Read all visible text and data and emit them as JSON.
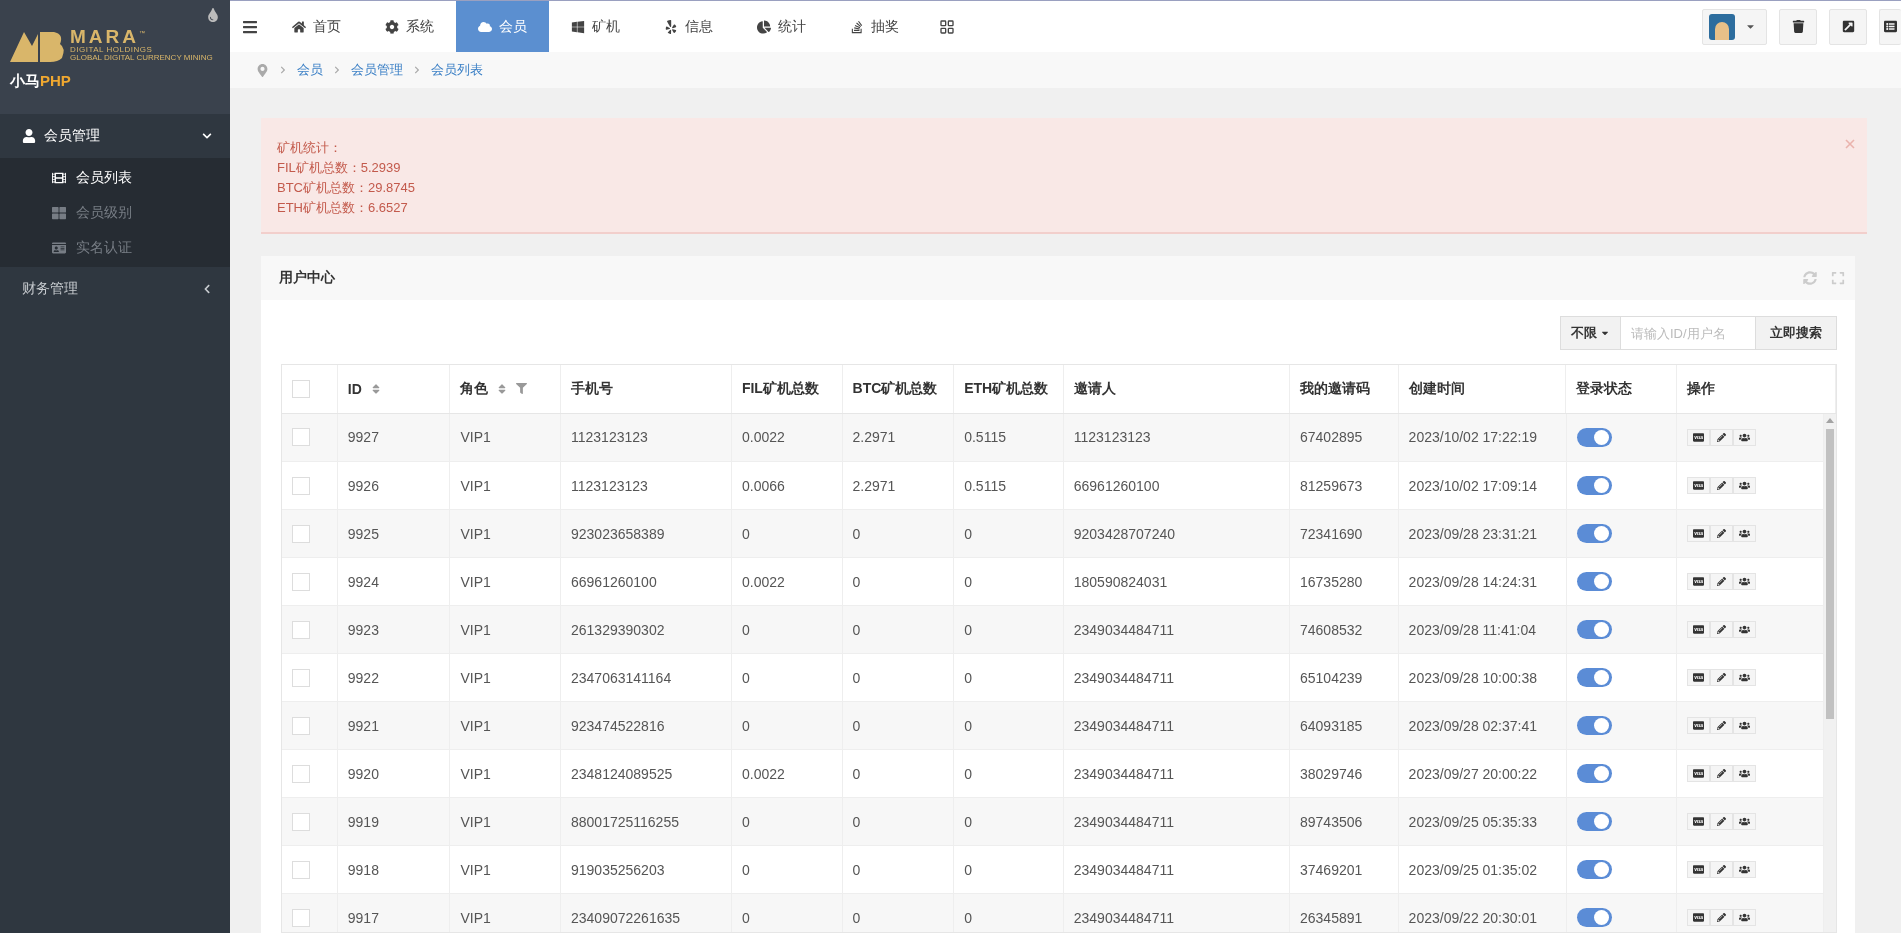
{
  "sidebar": {
    "logo": {
      "name": "MARA",
      "tm": "™",
      "subtitle": "DIGITAL HOLDINGS",
      "tagline": "GLOBAL DIGITAL CURRENCY MINING"
    },
    "brand": {
      "cn": "小马",
      "en": "PHP"
    },
    "menu": [
      {
        "label": "会员管理",
        "expanded": true,
        "children": [
          {
            "label": "会员列表",
            "selected": true
          },
          {
            "label": "会员级别",
            "selected": false
          },
          {
            "label": "实名认证",
            "selected": false
          }
        ]
      },
      {
        "label": "财务管理",
        "expanded": false
      }
    ]
  },
  "topnav": {
    "tabs": [
      {
        "label": "首页",
        "selected": false
      },
      {
        "label": "系统",
        "selected": false
      },
      {
        "label": "会员",
        "selected": true
      },
      {
        "label": "矿机",
        "selected": false
      },
      {
        "label": "信息",
        "selected": false
      },
      {
        "label": "统计",
        "selected": false
      },
      {
        "label": "抽奖",
        "selected": false
      }
    ]
  },
  "breadcrumb": [
    "会员",
    "会员管理",
    "会员列表"
  ],
  "alert": {
    "lines": [
      "矿机统计：",
      "FIL矿机总数：5.2939",
      "BTC矿机总数：29.8745",
      "ETH矿机总数：6.6527"
    ]
  },
  "panel": {
    "title": "用户中心",
    "filter": {
      "value": "不限"
    },
    "search": {
      "placeholder": "请输入ID/用户名"
    },
    "search_button": "立即搜索"
  },
  "table": {
    "all_checked": false,
    "columns": [
      {
        "label": "ID",
        "kind": "sort"
      },
      {
        "label": "角色",
        "kind": "sortfilter"
      },
      {
        "label": "手机号",
        "kind": "plain"
      },
      {
        "label": "FIL矿机总数",
        "kind": "plain"
      },
      {
        "label": "BTC矿机总数",
        "kind": "plain"
      },
      {
        "label": "ETH矿机总数",
        "kind": "plain"
      },
      {
        "label": "邀请人",
        "kind": "plain"
      },
      {
        "label": "我的邀请码",
        "kind": "plain"
      },
      {
        "label": "创建时间",
        "kind": "plain"
      },
      {
        "label": "登录状态",
        "kind": "plain"
      },
      {
        "label": "操作",
        "kind": "plain"
      }
    ],
    "rows": [
      {
        "checked": false,
        "login_enabled": true,
        "cells": [
          "9927",
          "VIP1",
          "1123123123",
          "0.0022",
          "2.2971",
          "0.5115",
          "1123123123",
          "67402895",
          "2023/10/02 17:22:19"
        ]
      },
      {
        "checked": false,
        "login_enabled": true,
        "cells": [
          "9926",
          "VIP1",
          "1123123123",
          "0.0066",
          "2.2971",
          "0.5115",
          "66961260100",
          "81259673",
          "2023/10/02 17:09:14"
        ]
      },
      {
        "checked": false,
        "login_enabled": true,
        "cells": [
          "9925",
          "VIP1",
          "923023658389",
          "0",
          "0",
          "0",
          "9203428707240",
          "72341690",
          "2023/09/28 23:31:21"
        ]
      },
      {
        "checked": false,
        "login_enabled": true,
        "cells": [
          "9924",
          "VIP1",
          "66961260100",
          "0.0022",
          "0",
          "0",
          "180590824031",
          "16735280",
          "2023/09/28 14:24:31"
        ]
      },
      {
        "checked": false,
        "login_enabled": true,
        "cells": [
          "9923",
          "VIP1",
          "261329390302",
          "0",
          "0",
          "0",
          "2349034484711",
          "74608532",
          "2023/09/28 11:41:04"
        ]
      },
      {
        "checked": false,
        "login_enabled": true,
        "cells": [
          "9922",
          "VIP1",
          "2347063141164",
          "0",
          "0",
          "0",
          "2349034484711",
          "65104239",
          "2023/09/28 10:00:38"
        ]
      },
      {
        "checked": false,
        "login_enabled": true,
        "cells": [
          "9921",
          "VIP1",
          "923474522816",
          "0",
          "0",
          "0",
          "2349034484711",
          "64093185",
          "2023/09/28 02:37:41"
        ]
      },
      {
        "checked": false,
        "login_enabled": true,
        "cells": [
          "9920",
          "VIP1",
          "2348124089525",
          "0.0022",
          "0",
          "0",
          "2349034484711",
          "38029746",
          "2023/09/27 20:00:22"
        ]
      },
      {
        "checked": false,
        "login_enabled": true,
        "cells": [
          "9919",
          "VIP1",
          "88001725116255",
          "0",
          "0",
          "0",
          "2349034484711",
          "89743506",
          "2023/09/25 05:35:33"
        ]
      },
      {
        "checked": false,
        "login_enabled": true,
        "cells": [
          "9918",
          "VIP1",
          "919035256203",
          "0",
          "0",
          "0",
          "2349034484711",
          "37469201",
          "2023/09/25 01:35:02"
        ]
      },
      {
        "checked": false,
        "login_enabled": true,
        "cells": [
          "9917",
          "VIP1",
          "23409072261635",
          "0",
          "0",
          "0",
          "2349034484711",
          "26345891",
          "2023/09/22 20:30:01"
        ]
      }
    ]
  }
}
